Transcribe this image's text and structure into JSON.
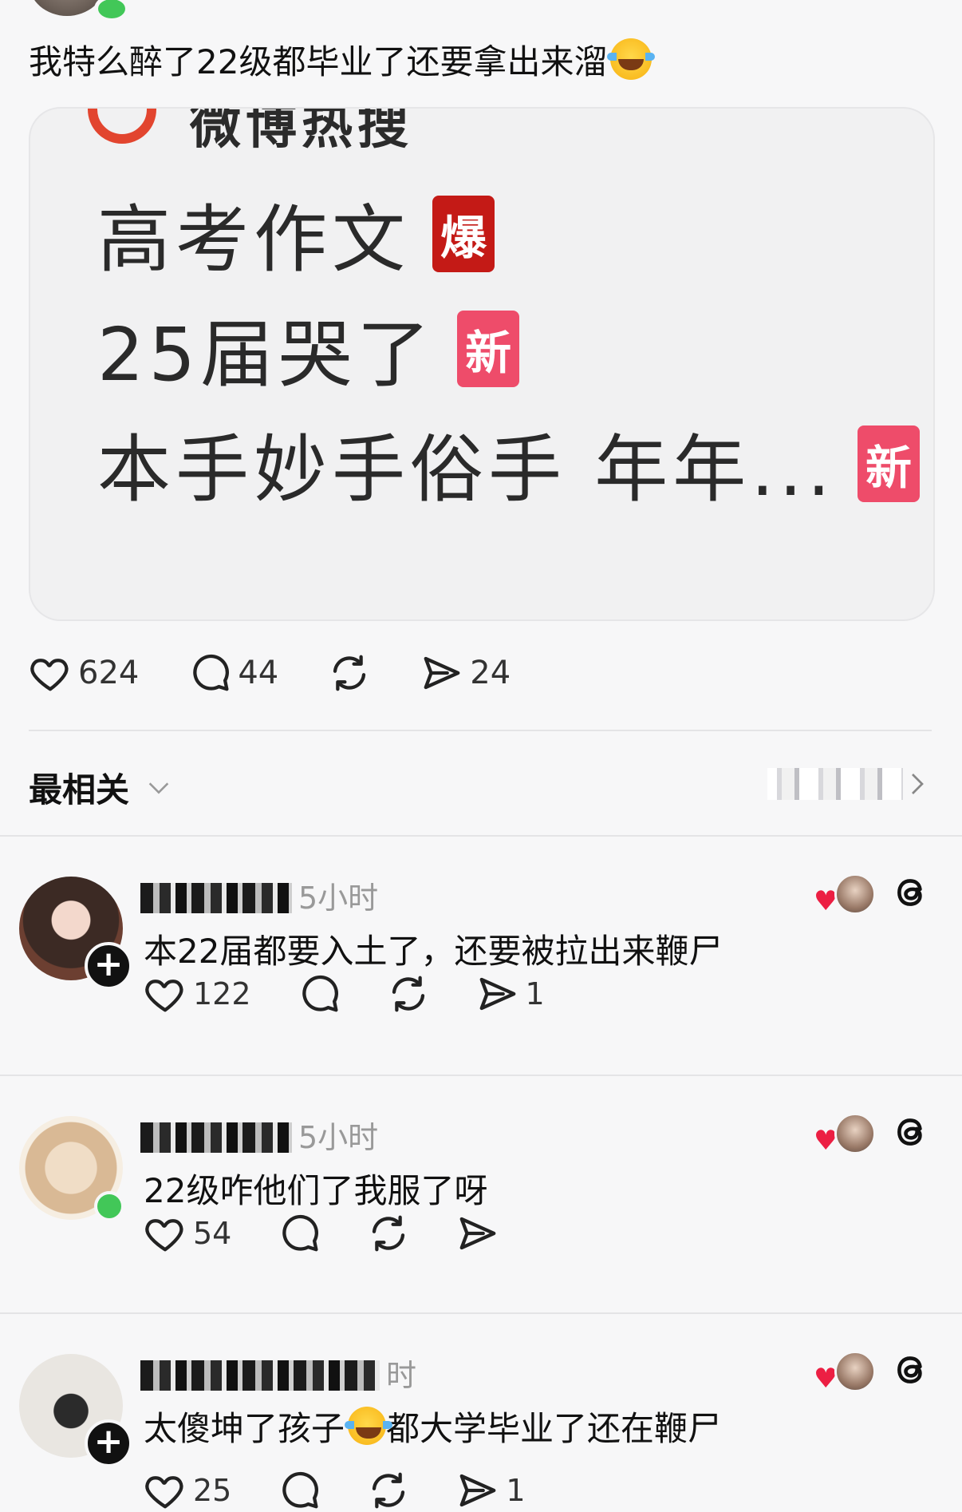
{
  "post": {
    "text": "我特么醉了22级都毕业了还要拿出来溜",
    "emoji": "laughing-with-tears-emoji",
    "image": {
      "header": "微博热搜",
      "hot_items": [
        {
          "label": "高考作文",
          "tag": "爆",
          "tag_color": "#c41a16"
        },
        {
          "label": "25届哭了",
          "tag": "新",
          "tag_color": "#ee4c6a"
        },
        {
          "label": "本手妙手俗手 年年...",
          "tag": "新",
          "tag_color": "#ee4c6a"
        }
      ]
    },
    "actions": {
      "likes": "624",
      "comments": "44",
      "shares": "24"
    }
  },
  "sort": {
    "label": "最相关"
  },
  "comments": [
    {
      "time": "5小时",
      "text": "本22届都要入土了，还要被拉出来鞭尸",
      "likes": "122",
      "comments": "",
      "shares": "1",
      "avatar_badge": "follow"
    },
    {
      "time": "5小时",
      "text": "22级咋他们了我服了呀",
      "likes": "54",
      "comments": "",
      "shares": "",
      "avatar_badge": "online"
    },
    {
      "time": "时",
      "text_before": "太傻坤了孩子",
      "text_after": "都大学毕业了还在鞭尸",
      "likes": "25",
      "comments": "",
      "shares": "1",
      "avatar_badge": "follow"
    }
  ],
  "colors": {
    "accent_red": "#ec1f43",
    "online_green": "#42c758",
    "muted": "#999999"
  }
}
